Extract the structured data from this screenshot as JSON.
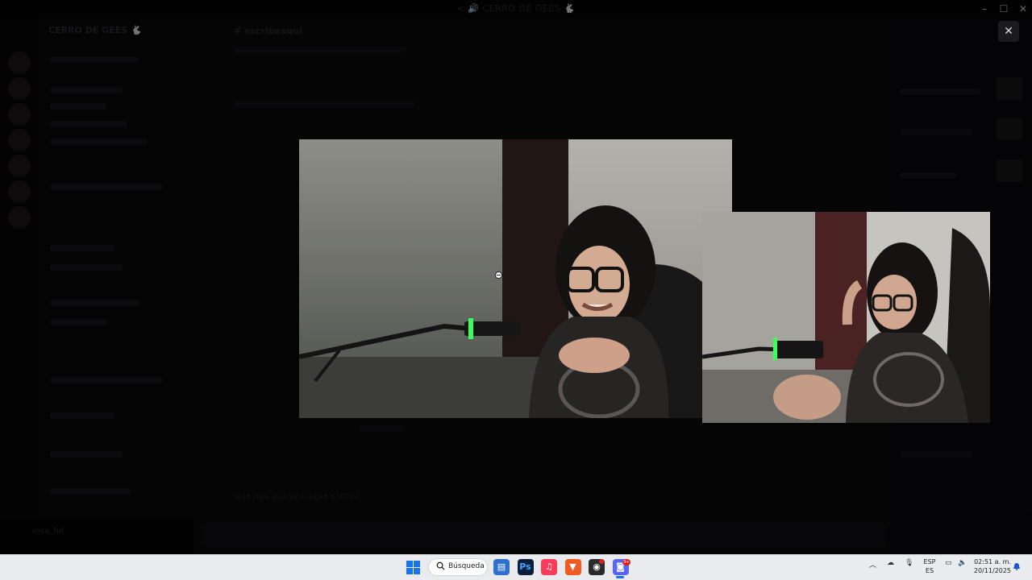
{
  "window": {
    "title": "< 🔊 CERRO DE GEES 🐇",
    "controls": [
      "minimize",
      "maximize",
      "close"
    ]
  },
  "discord": {
    "server_name": "CERRO DE GEES 🐇",
    "channel_title": "# escribeaqui",
    "chat_message": "JAJA JAJA JAJA JA AHAHA CITT1A",
    "user_name": "rosa_hd"
  },
  "viewer": {
    "close_label": "✕",
    "main_stream_label": "Main stream video",
    "pip_stream_label": "Picture-in-picture stream video"
  },
  "taskbar": {
    "search_label": "Búsqueda",
    "apps": [
      {
        "name": "file-explorer-icon",
        "glyph": "▤",
        "bg": "#2f6fcf",
        "fg": "#fff"
      },
      {
        "name": "photoshop-icon",
        "glyph": "Ps",
        "bg": "#0b1f3a",
        "fg": "#4aa3ff"
      },
      {
        "name": "music-icon",
        "glyph": "♫",
        "bg": "#fb3b5a",
        "fg": "#fff"
      },
      {
        "name": "brave-icon",
        "glyph": "▼",
        "bg": "#f05a23",
        "fg": "#fff"
      },
      {
        "name": "obs-icon",
        "glyph": "◉",
        "bg": "#2b2b2b",
        "fg": "#fff"
      },
      {
        "name": "discord-icon",
        "glyph": "◙",
        "bg": "#5865f2",
        "fg": "#fff"
      }
    ],
    "discord_badge": "9+",
    "language_top": "ESP",
    "language_bottom": "ES",
    "time": "02:51 a. m.",
    "date": "20/11/2025"
  },
  "colors": {
    "accent": "#5865f2",
    "taskbar_bg": "#e9ebef",
    "mic_glow": "#39ff5a"
  }
}
